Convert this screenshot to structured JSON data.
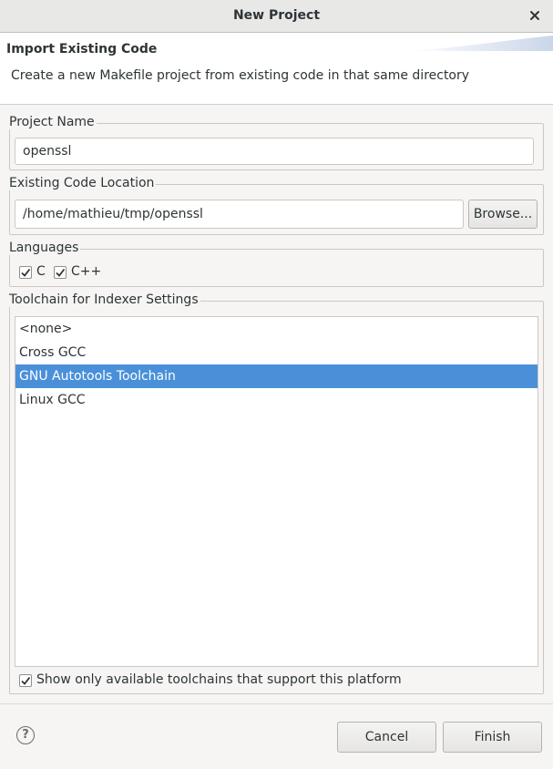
{
  "window": {
    "title": "New Project",
    "close_icon": "close-icon"
  },
  "header": {
    "heading": "Import Existing Code",
    "description": "Create a new Makefile project from existing code in that same directory"
  },
  "project_name": {
    "label": "Project Name",
    "value": "openssl"
  },
  "code_location": {
    "label": "Existing Code Location",
    "value": "/home/mathieu/tmp/openssl",
    "browse_label": "Browse..."
  },
  "languages": {
    "label": "Languages",
    "options": [
      {
        "label": "C",
        "checked": true
      },
      {
        "label": "C++",
        "checked": true
      }
    ]
  },
  "toolchain": {
    "label": "Toolchain for Indexer Settings",
    "items": [
      {
        "label": "<none>",
        "selected": false
      },
      {
        "label": "Cross GCC",
        "selected": false
      },
      {
        "label": "GNU Autotools Toolchain",
        "selected": true
      },
      {
        "label": "Linux GCC",
        "selected": false
      }
    ],
    "filter": {
      "label": "Show only available toolchains that support this platform",
      "checked": true
    }
  },
  "footer": {
    "help_icon": "help-icon",
    "help_glyph": "?",
    "cancel_label": "Cancel",
    "finish_label": "Finish"
  },
  "colors": {
    "selection": "#4a90d9",
    "background": "#f6f5f4"
  }
}
